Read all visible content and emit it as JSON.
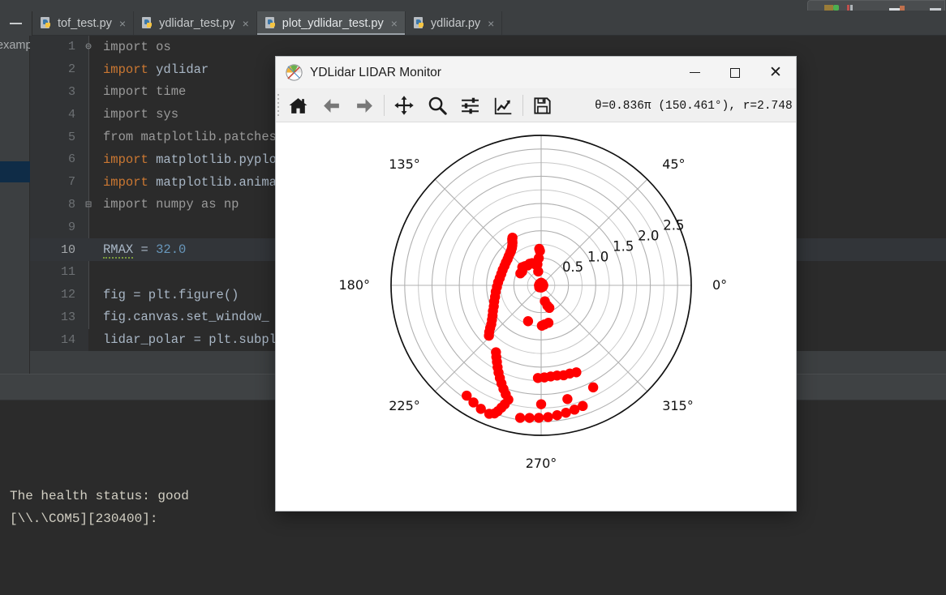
{
  "ide": {
    "minimize_button_label": "—",
    "tool_strip": {
      "label": "examp",
      "label_full": "examp"
    },
    "tabs": [
      {
        "label": "tof_test.py",
        "icon": "python-file-icon",
        "close": "×",
        "active": false
      },
      {
        "label": "ydlidar_test.py",
        "icon": "python-file-icon",
        "close": "×",
        "active": false
      },
      {
        "label": "plot_ydlidar_test.py",
        "icon": "python-file-icon",
        "close": "×",
        "active": true
      },
      {
        "label": "ydlidar.py",
        "icon": "python-file-icon",
        "close": "×",
        "active": false
      }
    ],
    "code_lines": [
      {
        "n": "1",
        "fold": "minus",
        "html": "<span class=\"mod\">import os</span>",
        "hl": false
      },
      {
        "n": "2",
        "fold": "",
        "html": "<span class=\"kw\">import</span> <span class=\"var\">ydlidar</span>",
        "hl": false
      },
      {
        "n": "3",
        "fold": "",
        "html": "<span class=\"mod\">import time</span>",
        "hl": false
      },
      {
        "n": "4",
        "fold": "",
        "html": "<span class=\"mod\">import sys</span>",
        "hl": false
      },
      {
        "n": "5",
        "fold": "",
        "html": "<span class=\"mod\">from matplotlib.patches</span>",
        "hl": false
      },
      {
        "n": "6",
        "fold": "",
        "html": "<span class=\"kw\">import</span> <span class=\"var\">matplotlib.pyplo</span>",
        "hl": false
      },
      {
        "n": "7",
        "fold": "",
        "html": "<span class=\"kw\">import</span> <span class=\"var\">matplotlib.anima</span>",
        "hl": false
      },
      {
        "n": "8",
        "fold": "end",
        "html": "<span class=\"mod\">import numpy as np</span>",
        "hl": false
      },
      {
        "n": "9",
        "fold": "",
        "html": "",
        "hl": false
      },
      {
        "n": "10",
        "fold": "",
        "html": "<span class=\"squig\">RMAX</span> = <span class=\"num\">32.0</span>",
        "hl": true
      },
      {
        "n": "11",
        "fold": "",
        "html": "",
        "hl": false
      },
      {
        "n": "12",
        "fold": "",
        "html": "fig = plt.figure()",
        "hl": false
      },
      {
        "n": "13",
        "fold": "",
        "html": "fig.canvas.set_window_",
        "hl": false
      },
      {
        "n": "14",
        "fold": "",
        "html": "lidar_polar = plt.subpl",
        "hl": false
      }
    ],
    "code_text_plain": [
      "import os",
      "import ydlidar",
      "import time",
      "import sys",
      "from matplotlib.patches",
      "import matplotlib.pyplo",
      "import matplotlib.anima",
      "import numpy as np",
      "",
      "RMAX = 32.0",
      "",
      "fig = plt.figure()",
      "fig.canvas.set_window_",
      "lidar_polar = plt.subpl"
    ],
    "console_lines": [
      "The health status: good",
      "[\\\\.\\COM5][230400]:"
    ]
  },
  "mpl_window": {
    "title": "YDLidar LIDAR Monitor",
    "icon": "matplotlib-logo-icon",
    "window_controls": {
      "minimize": "minimize-icon",
      "maximize": "maximize-icon",
      "close": "✕"
    },
    "toolbar_buttons": [
      {
        "name": "home-icon",
        "tooltip": "Home"
      },
      {
        "name": "back-arrow-icon",
        "tooltip": "Back"
      },
      {
        "name": "forward-arrow-icon",
        "tooltip": "Forward"
      },
      {
        "name": "pan-move-icon",
        "tooltip": "Pan"
      },
      {
        "name": "zoom-magnifier-icon",
        "tooltip": "Zoom to rectangle"
      },
      {
        "name": "subplot-sliders-icon",
        "tooltip": "Configure subplots"
      },
      {
        "name": "edit-curves-chart-icon",
        "tooltip": "Edit axis, curve and image parameters"
      },
      {
        "name": "save-floppy-icon",
        "tooltip": "Save the figure"
      }
    ],
    "coord_readout": "θ=0.836π  (150.461°),  r=2.748"
  },
  "chart_data": {
    "type": "scatter",
    "projection": "polar",
    "title": "",
    "xlabel": "",
    "ylabel": "",
    "grid": true,
    "legend": null,
    "marker_color": "#ff0000",
    "marker_size": 12,
    "theta_unit": "degrees",
    "theta_tick_labels": [
      "0°",
      "45°",
      "90°",
      "135°",
      "180°",
      "225°",
      "270°",
      "315°"
    ],
    "theta_ticks": [
      0,
      45,
      90,
      135,
      180,
      225,
      270,
      315
    ],
    "theta_direction": "counterclockwise",
    "theta_zero_location": "E",
    "r_tick_labels": [
      "0.5",
      "1.0",
      "1.5",
      "2.0",
      "2.5"
    ],
    "r_ticks": [
      0.5,
      1.0,
      1.5,
      2.0,
      2.5
    ],
    "rlim": [
      0,
      2.75
    ],
    "r_label_angle": 22.5,
    "points": [
      {
        "theta": 95,
        "r": 0.5
      },
      {
        "theta": 92,
        "r": 0.63
      },
      {
        "theta": 93,
        "r": 0.67
      },
      {
        "theta": 112,
        "r": 0.44
      },
      {
        "theta": 118,
        "r": 0.45
      },
      {
        "theta": 124,
        "r": 0.44
      },
      {
        "theta": 130,
        "r": 0.46
      },
      {
        "theta": 136,
        "r": 0.48
      },
      {
        "theta": 106,
        "r": 0.4
      },
      {
        "theta": 100,
        "r": 0.39
      },
      {
        "theta": 144,
        "r": 0.43
      },
      {
        "theta": 150,
        "r": 0.44
      },
      {
        "theta": 102,
        "r": 0.26
      },
      {
        "theta": 121,
        "r": 1.02
      },
      {
        "theta": 122,
        "r": 1.0
      },
      {
        "theta": 123,
        "r": 0.97
      },
      {
        "theta": 124,
        "r": 0.94
      },
      {
        "theta": 126,
        "r": 0.9
      },
      {
        "theta": 128,
        "r": 0.87
      },
      {
        "theta": 131,
        "r": 0.84
      },
      {
        "theta": 134,
        "r": 0.82
      },
      {
        "theta": 138,
        "r": 0.8
      },
      {
        "theta": 142,
        "r": 0.78
      },
      {
        "theta": 147,
        "r": 0.77
      },
      {
        "theta": 152,
        "r": 0.76
      },
      {
        "theta": 158,
        "r": 0.76
      },
      {
        "theta": 164,
        "r": 0.76
      },
      {
        "theta": 170,
        "r": 0.77
      },
      {
        "theta": 176,
        "r": 0.79
      },
      {
        "theta": 182,
        "r": 0.81
      },
      {
        "theta": 188,
        "r": 0.84
      },
      {
        "theta": 194,
        "r": 0.87
      },
      {
        "theta": 199,
        "r": 0.91
      },
      {
        "theta": 204,
        "r": 0.95
      },
      {
        "theta": 208,
        "r": 1.0
      },
      {
        "theta": 212,
        "r": 1.05
      },
      {
        "theta": 215,
        "r": 1.1
      },
      {
        "theta": 218,
        "r": 1.16
      },
      {
        "theta": 220,
        "r": 1.22
      },
      {
        "theta": 222,
        "r": 1.28
      },
      {
        "theta": 224,
        "r": 1.33
      },
      {
        "theta": 283,
        "r": 0.3
      },
      {
        "theta": 287,
        "r": 0.39
      },
      {
        "theta": 290,
        "r": 0.44
      },
      {
        "theta": 281,
        "r": 0.7
      },
      {
        "theta": 275,
        "r": 0.72
      },
      {
        "theta": 271,
        "r": 0.74
      },
      {
        "theta": 250,
        "r": 0.7
      },
      {
        "theta": 236,
        "r": 1.48
      },
      {
        "theta": 238,
        "r": 1.55
      },
      {
        "theta": 240,
        "r": 1.62
      },
      {
        "theta": 242,
        "r": 1.7
      },
      {
        "theta": 244,
        "r": 1.78
      },
      {
        "theta": 246,
        "r": 1.86
      },
      {
        "theta": 248,
        "r": 1.94
      },
      {
        "theta": 250,
        "r": 2.02
      },
      {
        "theta": 252,
        "r": 2.1
      },
      {
        "theta": 254,
        "r": 2.18
      },
      {
        "theta": 253,
        "r": 2.28
      },
      {
        "theta": 252,
        "r": 2.36
      },
      {
        "theta": 251,
        "r": 2.44
      },
      {
        "theta": 250,
        "r": 2.5
      },
      {
        "theta": 248,
        "r": 2.54
      },
      {
        "theta": 244,
        "r": 2.52
      },
      {
        "theta": 240,
        "r": 2.48
      },
      {
        "theta": 236,
        "r": 2.44
      },
      {
        "theta": 261,
        "r": 2.46
      },
      {
        "theta": 265,
        "r": 2.44
      },
      {
        "theta": 269,
        "r": 2.43
      },
      {
        "theta": 273,
        "r": 2.42
      },
      {
        "theta": 277,
        "r": 2.4
      },
      {
        "theta": 281,
        "r": 2.38
      },
      {
        "theta": 285,
        "r": 2.36
      },
      {
        "theta": 289,
        "r": 2.34
      },
      {
        "theta": 270,
        "r": 2.18
      },
      {
        "theta": 283,
        "r": 2.14
      },
      {
        "theta": 297,
        "r": 2.1
      },
      {
        "theta": 268,
        "r": 1.7
      },
      {
        "theta": 272,
        "r": 1.69
      },
      {
        "theta": 276,
        "r": 1.68
      },
      {
        "theta": 280,
        "r": 1.68
      },
      {
        "theta": 284,
        "r": 1.7
      },
      {
        "theta": 288,
        "r": 1.7
      },
      {
        "theta": 292,
        "r": 1.72
      },
      {
        "theta": 0,
        "r": 0.04
      },
      {
        "theta": 45,
        "r": 0.04
      },
      {
        "theta": 90,
        "r": 0.05
      },
      {
        "theta": 135,
        "r": 0.04
      },
      {
        "theta": 180,
        "r": 0.04
      },
      {
        "theta": 225,
        "r": 0.05
      },
      {
        "theta": 270,
        "r": 0.04
      },
      {
        "theta": 315,
        "r": 0.04
      }
    ]
  }
}
